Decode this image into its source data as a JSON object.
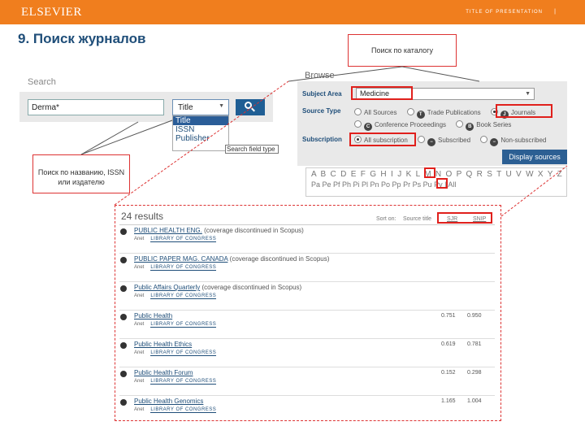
{
  "header": {
    "logo": "ELSEVIER",
    "presentation_title": "TITLE OF PRESENTATION",
    "page_marker": "|",
    "bar_color": "#f07e1e"
  },
  "slide_title": "9. Поиск журналов",
  "search": {
    "label": "Search",
    "query": "Derma*",
    "field_selected": "Title",
    "field_options": [
      "Title",
      "ISSN",
      "Publisher"
    ],
    "field_hint": "Search field type",
    "button_icon": "search-icon"
  },
  "callouts": {
    "search_by": "Поиск по названию, ISSN или издателю",
    "catalog": "Поиск по каталогу"
  },
  "browse": {
    "label": "Browse",
    "subject_area_label": "Subject Area",
    "subject_area_value": "Medicine",
    "source_type_label": "Source Type",
    "source_types": [
      {
        "badge": "",
        "label": "All Sources"
      },
      {
        "badge": "T",
        "label": "Trade Publications"
      },
      {
        "badge": "J",
        "label": "Journals"
      },
      {
        "badge": "C",
        "label": "Conference Proceedings"
      },
      {
        "badge": "B",
        "label": "Book Series"
      }
    ],
    "subscription_label": "Subscription",
    "subscriptions": [
      "All subscription",
      "Subscribed",
      "Non-subscribed"
    ],
    "display_button": "Display sources",
    "alphabet": "A B C D E F G H I J K L M N O P Q R S T U V W X Y Z",
    "sub_letters": "Pa Pe Pf Ph Pi Pl Pn Po Pp Pr Ps Pu Py | All"
  },
  "results": {
    "count": "24 results",
    "sort_on": "Sort on:",
    "sort_title": "Source title",
    "sort_sjr": "SJR",
    "sort_snip": "SNIP",
    "rows": [
      {
        "title": "PUBLIC HEALTH ENG.",
        "note": " (coverage discontinued in Scopus)",
        "sub": "Anet",
        "lib": "LIBRARY OF CONGRESS",
        "sjr": "",
        "snip": ""
      },
      {
        "title": "PUBLIC PAPER MAG. CANADA",
        "note": " (coverage discontinued in Scopus)",
        "sub": "Anet",
        "lib": "LIBRARY OF CONGRESS",
        "sjr": "",
        "snip": ""
      },
      {
        "title": "Public Affairs Quarterly",
        "note": " (coverage discontinued in Scopus)",
        "sub": "Anet",
        "lib": "LIBRARY OF CONGRESS",
        "sjr": "",
        "snip": ""
      },
      {
        "title": "Public Health",
        "note": "",
        "sub": "Anet",
        "lib": "LIBRARY OF CONGRESS",
        "sjr": "0.751",
        "snip": "0.950"
      },
      {
        "title": "Public Health Ethics",
        "note": "",
        "sub": "Anet",
        "lib": "LIBRARY OF CONGRESS",
        "sjr": "0.619",
        "snip": "0.781"
      },
      {
        "title": "Public Health Forum",
        "note": "",
        "sub": "Anet",
        "lib": "LIBRARY OF CONGRESS",
        "sjr": "0.152",
        "snip": "0.298"
      },
      {
        "title": "Public Health Genomics",
        "note": "",
        "sub": "Anet",
        "lib": "LIBRARY OF CONGRESS",
        "sjr": "1.165",
        "snip": "1.004"
      }
    ]
  },
  "highlight_color": "#e0201c"
}
